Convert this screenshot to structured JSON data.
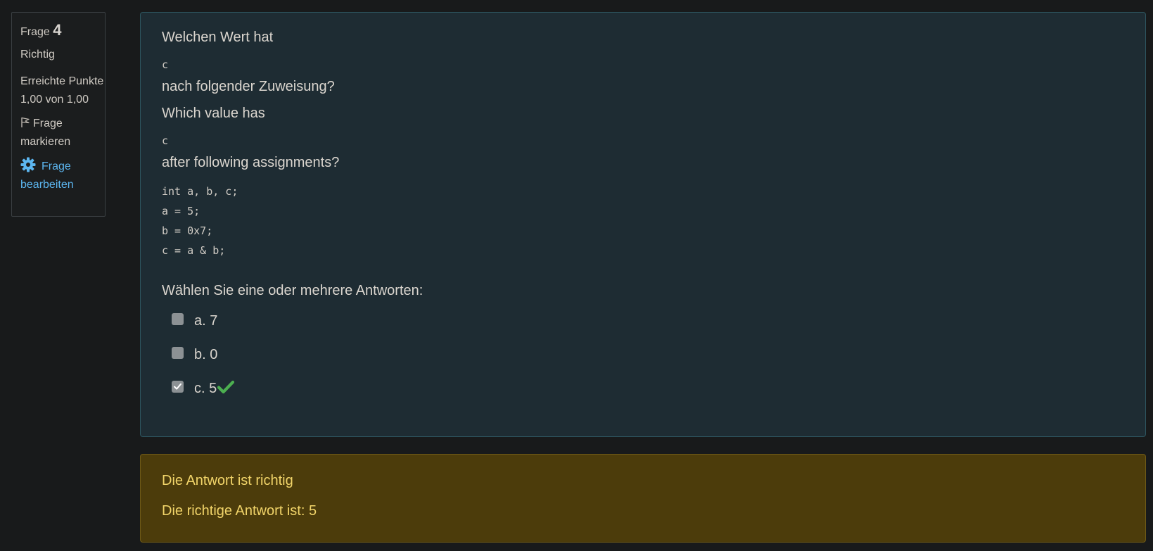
{
  "info": {
    "question_prefix": "Frage",
    "question_number": "4",
    "state": "Richtig",
    "grade": "Erreichte Punkte 1,00 von 1,00",
    "flag_label": "Frage markieren",
    "edit_label": "Frage bearbeiten",
    "icons": {
      "flag": "flag-icon",
      "edit": "gear-icon"
    },
    "edit_color": "#5cb6f0"
  },
  "question": {
    "line1": "Welchen Wert hat",
    "var1": "c",
    "line2": "nach folgender Zuweisung?",
    "line3": "Which value has",
    "var2": "c",
    "line4": "after following assignments?",
    "code": "int a, b, c;\na = 5;\nb = 0x7;\nc = a & b;"
  },
  "answer": {
    "prompt": "Wählen Sie eine oder mehrere Antworten:",
    "options": [
      {
        "label": "a. 7",
        "checked": false
      },
      {
        "label": "b. 0",
        "checked": false
      },
      {
        "label": "c. 5",
        "checked": true,
        "correct_icon": "check-icon"
      }
    ]
  },
  "outcome": {
    "feedback": "Die Antwort ist richtig",
    "right_answer": "Die richtige Antwort ist: 5"
  },
  "colors": {
    "background": "#181a1b",
    "question_panel": "#1e2c33",
    "feedback_panel": "#4c3c0b",
    "feedback_text": "#f1d469",
    "correct": "#4caf50"
  }
}
